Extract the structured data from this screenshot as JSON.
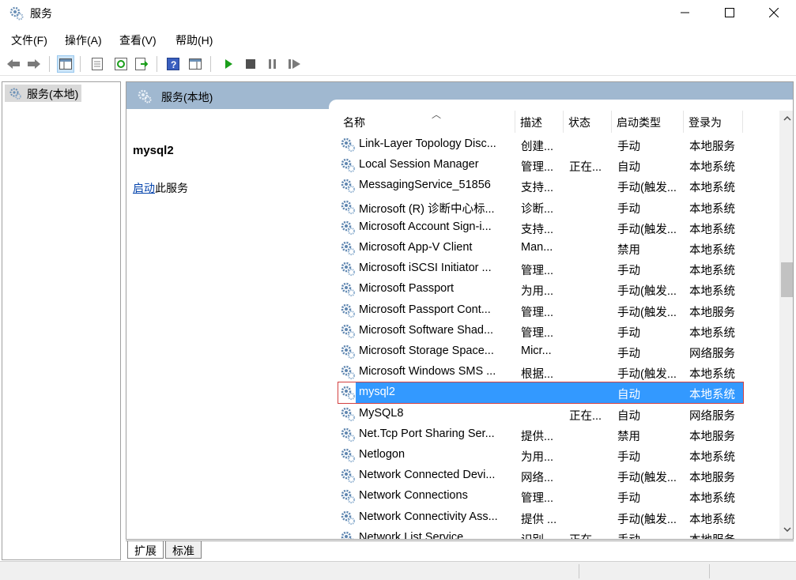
{
  "window": {
    "title": "服务",
    "minimize_icon": "minimize-icon",
    "maximize_icon": "maximize-icon",
    "close_icon": "close-icon"
  },
  "menu": [
    "文件(F)",
    "操作(A)",
    "查看(V)",
    "帮助(H)"
  ],
  "toolbar": {
    "icons": [
      "back-icon",
      "forward-icon",
      "show-hide-tree-icon",
      "properties-icon",
      "refresh-icon",
      "export-list-icon",
      "help-icon",
      "show-hide-action-pane-icon",
      "start-icon",
      "stop-icon",
      "pause-icon",
      "restart-icon"
    ],
    "colors": {
      "play": "#1a9e1a",
      "control": "#505050",
      "help": "#3a5fbf"
    }
  },
  "tree": {
    "root_label": "服务(本地)"
  },
  "right_header": {
    "title": "服务(本地)",
    "bg": "#a0b8d0"
  },
  "extended": {
    "service_name": "mysql2",
    "start_link": "启动",
    "start_suffix": "此服务"
  },
  "list": {
    "columns": [
      "名称",
      "描述",
      "状态",
      "启动类型",
      "登录为"
    ],
    "selected_color": "#3399ff",
    "rows": [
      {
        "name": "Link-Layer Topology Disc...",
        "desc": "创建...",
        "status": "",
        "startup": "手动",
        "logon": "本地服务"
      },
      {
        "name": "Local Session Manager",
        "desc": "管理...",
        "status": "正在...",
        "startup": "自动",
        "logon": "本地系统"
      },
      {
        "name": "MessagingService_51856",
        "desc": "支持...",
        "status": "",
        "startup": "手动(触发...",
        "logon": "本地系统"
      },
      {
        "name": "Microsoft (R) 诊断中心标...",
        "desc": "诊断...",
        "status": "",
        "startup": "手动",
        "logon": "本地系统"
      },
      {
        "name": "Microsoft Account Sign-i...",
        "desc": "支持...",
        "status": "",
        "startup": "手动(触发...",
        "logon": "本地系统"
      },
      {
        "name": "Microsoft App-V Client",
        "desc": "Man...",
        "status": "",
        "startup": "禁用",
        "logon": "本地系统"
      },
      {
        "name": "Microsoft iSCSI Initiator ...",
        "desc": "管理...",
        "status": "",
        "startup": "手动",
        "logon": "本地系统"
      },
      {
        "name": "Microsoft Passport",
        "desc": "为用...",
        "status": "",
        "startup": "手动(触发...",
        "logon": "本地系统"
      },
      {
        "name": "Microsoft Passport Cont...",
        "desc": "管理...",
        "status": "",
        "startup": "手动(触发...",
        "logon": "本地服务"
      },
      {
        "name": "Microsoft Software Shad...",
        "desc": "管理...",
        "status": "",
        "startup": "手动",
        "logon": "本地系统"
      },
      {
        "name": "Microsoft Storage Space...",
        "desc": "Micr...",
        "status": "",
        "startup": "手动",
        "logon": "网络服务"
      },
      {
        "name": "Microsoft Windows SMS ...",
        "desc": "根据...",
        "status": "",
        "startup": "手动(触发...",
        "logon": "本地系统"
      },
      {
        "name": "mysql2",
        "desc": "",
        "status": "",
        "startup": "自动",
        "logon": "本地系统",
        "selected": true
      },
      {
        "name": "MySQL8",
        "desc": "",
        "status": "正在...",
        "startup": "自动",
        "logon": "网络服务"
      },
      {
        "name": "Net.Tcp Port Sharing Ser...",
        "desc": "提供...",
        "status": "",
        "startup": "禁用",
        "logon": "本地服务"
      },
      {
        "name": "Netlogon",
        "desc": "为用...",
        "status": "",
        "startup": "手动",
        "logon": "本地系统"
      },
      {
        "name": "Network Connected Devi...",
        "desc": "网络...",
        "status": "",
        "startup": "手动(触发...",
        "logon": "本地服务"
      },
      {
        "name": "Network Connections",
        "desc": "管理...",
        "status": "",
        "startup": "手动",
        "logon": "本地系统"
      },
      {
        "name": "Network Connectivity Ass...",
        "desc": "提供 ...",
        "status": "",
        "startup": "手动(触发...",
        "logon": "本地系统"
      },
      {
        "name": "Network List Service",
        "desc": "识别...",
        "status": "正在...",
        "startup": "手动",
        "logon": "本地服务"
      }
    ]
  },
  "tabs": [
    "扩展",
    "标准"
  ]
}
